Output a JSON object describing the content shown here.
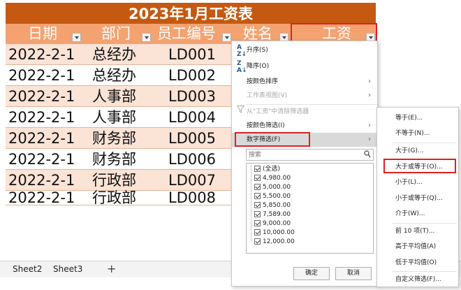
{
  "sheet": {
    "title": "2023年1月工资表",
    "headers": [
      "日期",
      "部门",
      "员工编号",
      "姓名",
      "工资"
    ],
    "rows": [
      [
        "2022-2-1",
        "总经办",
        "LD001"
      ],
      [
        "2022-2-1",
        "总经办",
        "LD002"
      ],
      [
        "2022-2-1",
        "人事部",
        "LD003"
      ],
      [
        "2022-2-1",
        "人事部",
        "LD004"
      ],
      [
        "2022-2-1",
        "财务部",
        "LD005"
      ],
      [
        "2022-2-1",
        "财务部",
        "LD006"
      ],
      [
        "2022-2-1",
        "行政部",
        "LD007"
      ],
      [
        "2022-2-1",
        "行政部",
        "LD008"
      ]
    ],
    "colors": {
      "title_bg": "#c65911",
      "header_bg": "#f4a270",
      "band": "#fbe3d6",
      "highlight": "#e02020"
    }
  },
  "tabs": {
    "sheets": [
      "Sheet2",
      "Sheet3"
    ],
    "add": "+"
  },
  "filter_menu": {
    "sort_asc": "升序(S)",
    "sort_desc": "降序(O)",
    "sort_by_color": "按颜色排序",
    "sheet_view": "工作表视图(V)",
    "clear_filter": "从\"工资\"中清除筛选器",
    "filter_by_color": "按颜色筛选(I)",
    "number_filters": "数字筛选(F)",
    "search_placeholder": "搜索",
    "values": [
      "(全选)",
      "4,980.00",
      "5,000.00",
      "5,500.00",
      "5,850.00",
      "7,589.00",
      "9,000.00",
      "10,000.00",
      "12,000.00"
    ],
    "ok": "确定",
    "cancel": "取消"
  },
  "number_filter_submenu": {
    "items": [
      "等于(E)...",
      "不等于(N)...",
      "大于(G)...",
      "大于或等于(O)...",
      "小于(L)...",
      "小于或等于(Q)...",
      "介于(W)...",
      "前 10 项(T)...",
      "高于平均值(A)",
      "低于平均值(O)",
      "自定义筛选(F)..."
    ]
  }
}
